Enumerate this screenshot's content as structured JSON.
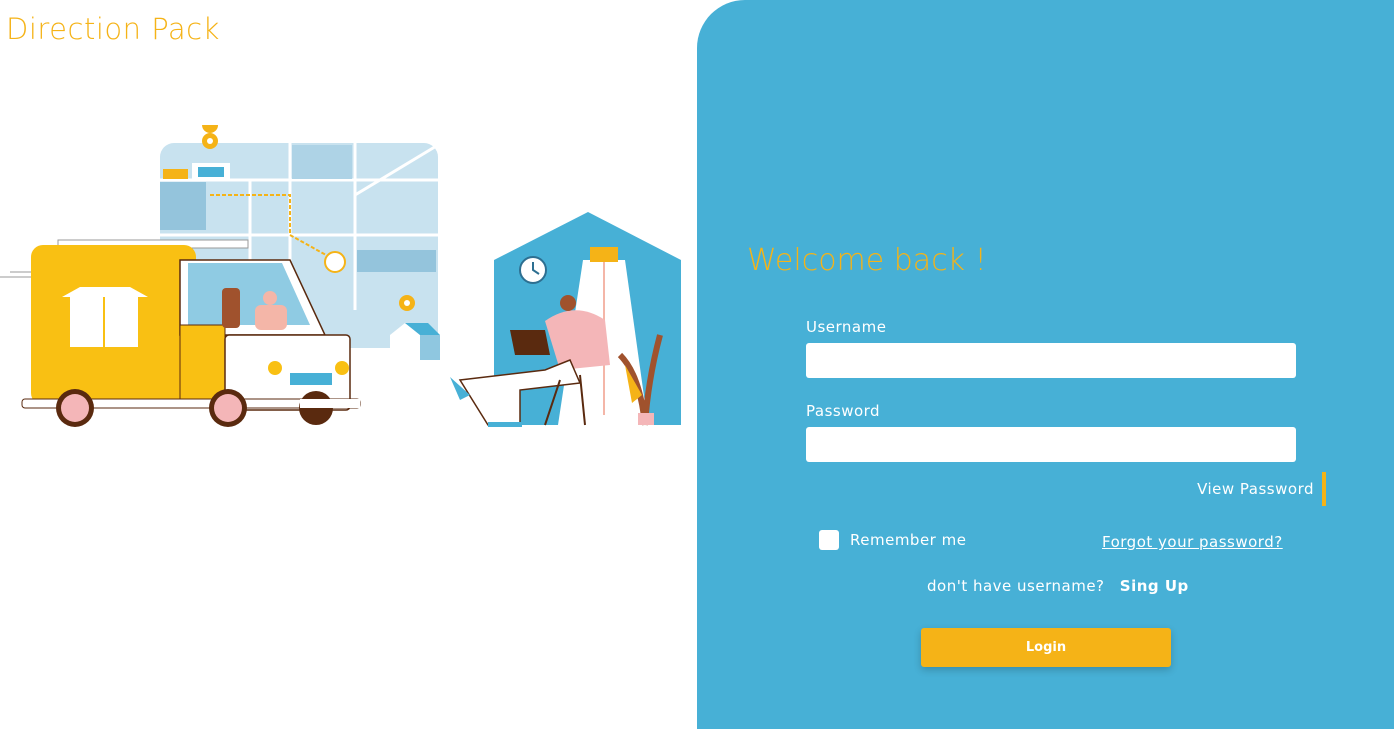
{
  "brand": {
    "title": "Direction Pack"
  },
  "login": {
    "welcome": "Welcome back !",
    "username_label": "Username",
    "username_value": "",
    "password_label": "Password",
    "password_value": "",
    "view_password": "View Password",
    "remember_me": "Remember me",
    "forgot_password": "Forgot your password?",
    "no_account_text": "don't have username?",
    "signup_link": "Sing Up",
    "login_button": "Login"
  },
  "colors": {
    "accent": "#f5b317",
    "panel": "#47b0d6",
    "map": "#c8e2ef"
  },
  "icons": {
    "illustration": "delivery-truck-and-map-illustration"
  }
}
